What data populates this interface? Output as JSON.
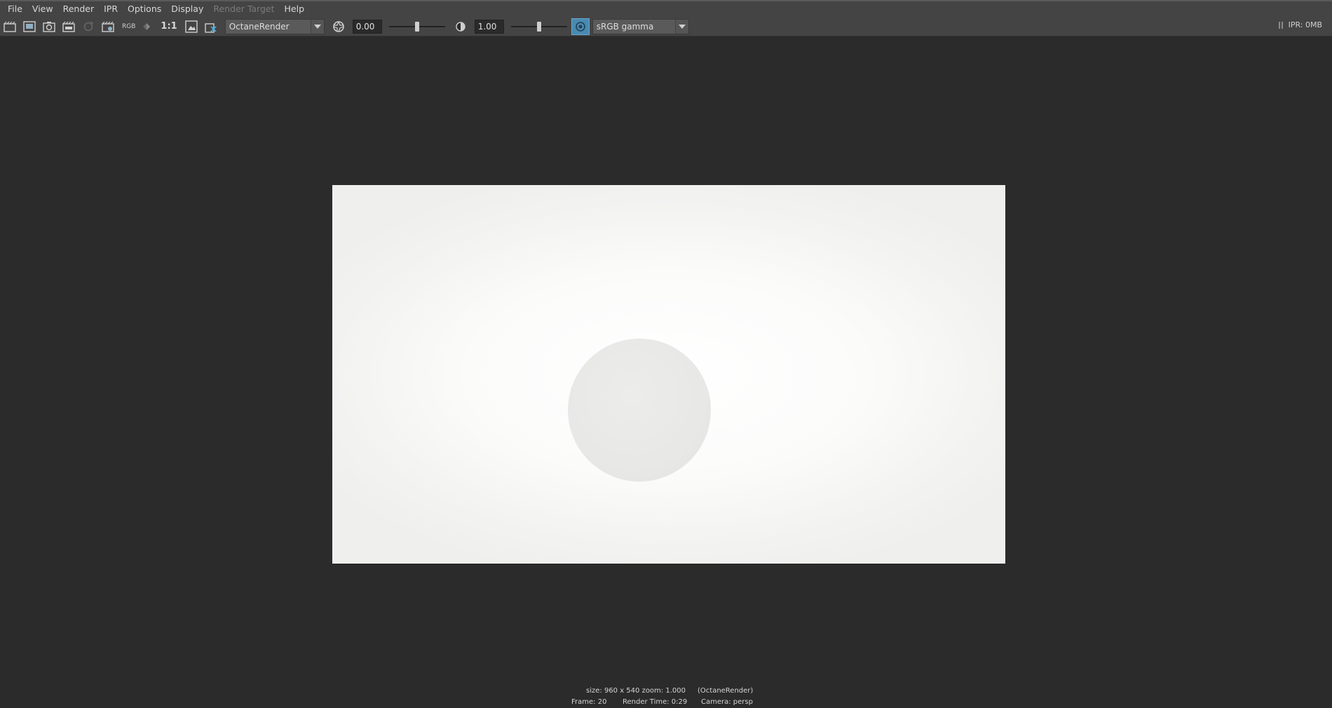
{
  "menu": {
    "items": [
      {
        "label": "File",
        "enabled": true
      },
      {
        "label": "View",
        "enabled": true
      },
      {
        "label": "Render",
        "enabled": true
      },
      {
        "label": "IPR",
        "enabled": true
      },
      {
        "label": "Options",
        "enabled": true
      },
      {
        "label": "Display",
        "enabled": true
      },
      {
        "label": "Render Target",
        "enabled": false
      },
      {
        "label": "Help",
        "enabled": true
      }
    ]
  },
  "toolbar": {
    "rgb_label": "RGB",
    "ratio_label": "1:1",
    "renderer": "OctaneRender",
    "exposure_value": "0.00",
    "exposure_slider_fraction": 0.5,
    "gamma_value": "1.00",
    "gamma_slider_fraction": 0.5,
    "color_space": "sRGB gamma",
    "gamma_active_color": "#4a8ab0"
  },
  "ipr": {
    "status": "IPR: 0MB"
  },
  "status": {
    "size_zoom": "size:  960 x 540  zoom: 1.000",
    "renderer": "(OctaneRender)",
    "frame": "Frame: 20",
    "render_time": "Render Time: 0:29",
    "camera": "Camera: persp"
  }
}
